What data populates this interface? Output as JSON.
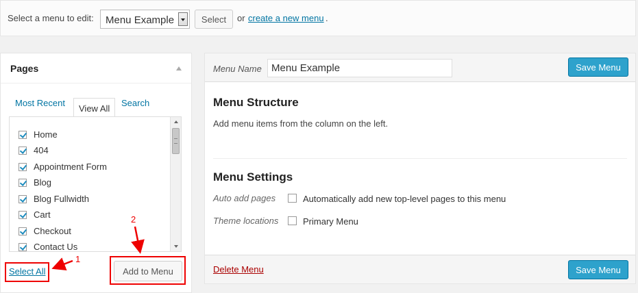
{
  "top": {
    "select_label": "Select a menu to edit:",
    "selected_menu": "Menu Example",
    "select_button": "Select",
    "or_text": "or",
    "create_link": "create a new menu",
    "period": "."
  },
  "pages": {
    "title": "Pages",
    "tabs": [
      {
        "label": "Most Recent"
      },
      {
        "label": "View All"
      },
      {
        "label": "Search"
      }
    ],
    "items": [
      {
        "label": "Home"
      },
      {
        "label": "404"
      },
      {
        "label": "Appointment Form"
      },
      {
        "label": "Blog"
      },
      {
        "label": "Blog Fullwidth"
      },
      {
        "label": "Cart"
      },
      {
        "label": "Checkout"
      },
      {
        "label": "Contact Us"
      }
    ],
    "select_all": "Select All",
    "add_button": "Add to Menu"
  },
  "annotations": {
    "one": "1",
    "two": "2",
    "color": "#ee0000"
  },
  "menu": {
    "name_label": "Menu Name",
    "name_value": "Menu Example",
    "save_label": "Save Menu",
    "structure_title": "Menu Structure",
    "structure_desc": "Add menu items from the column on the left.",
    "settings_title": "Menu Settings",
    "auto_add_label": "Auto add pages",
    "auto_add_text": "Automatically add new top-level pages to this menu",
    "theme_loc_label": "Theme locations",
    "theme_loc_text": "Primary Menu",
    "delete_label": "Delete Menu"
  },
  "colors": {
    "accent": "#2ea2cc",
    "link": "#0074a2",
    "delete": "#aa0000"
  }
}
